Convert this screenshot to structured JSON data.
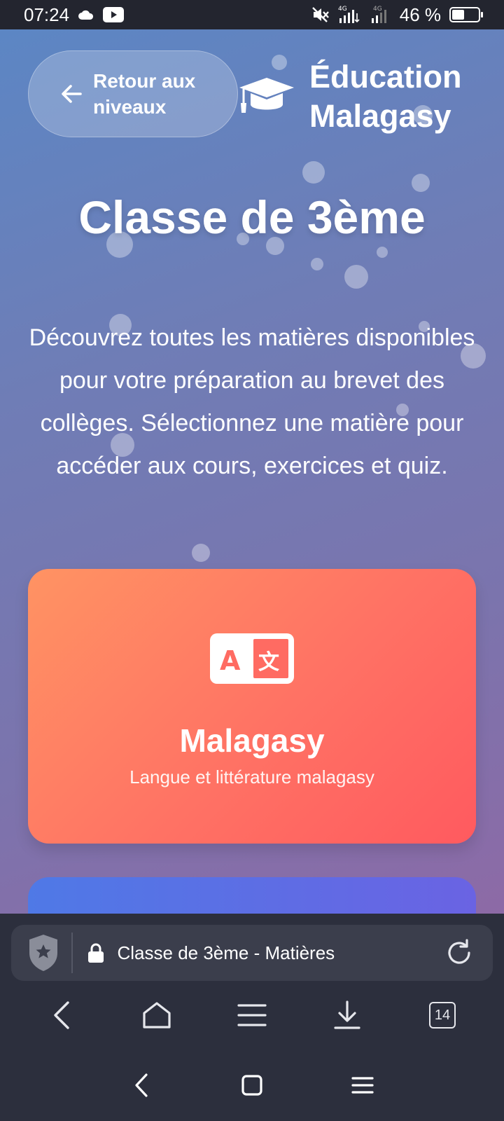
{
  "status_bar": {
    "time": "07:24",
    "battery": "46 %",
    "battery_fill": 0.46,
    "icons": [
      "cloud-icon",
      "youtube-icon",
      "mute-icon",
      "signal-4g-icon",
      "signal-4g-2-icon",
      "battery-icon"
    ]
  },
  "header": {
    "back_label": "Retour aux niveaux",
    "brand_name": "Éducation Malagasy",
    "brand_icon": "graduation-cap-icon"
  },
  "main": {
    "title": "Classe de 3ème",
    "intro": "Découvrez toutes les matières disponibles pour votre préparation au brevet des collèges. Sélectionnez une matière pour accéder aux cours, exercices et quiz.",
    "subjects": [
      {
        "name": "Malagasy",
        "description": "Langue et littérature malagasy",
        "icon": "language-translate-icon",
        "color_start": "#ff9363",
        "color_end": "#ff5a5f"
      }
    ]
  },
  "browser": {
    "page_title": "Classe de 3ème - Matières",
    "tab_count": "14"
  },
  "colors": {
    "accent_orange": "#ff7264",
    "accent_blue": "#5c74e4",
    "browser_bg": "#2c2f3d"
  }
}
